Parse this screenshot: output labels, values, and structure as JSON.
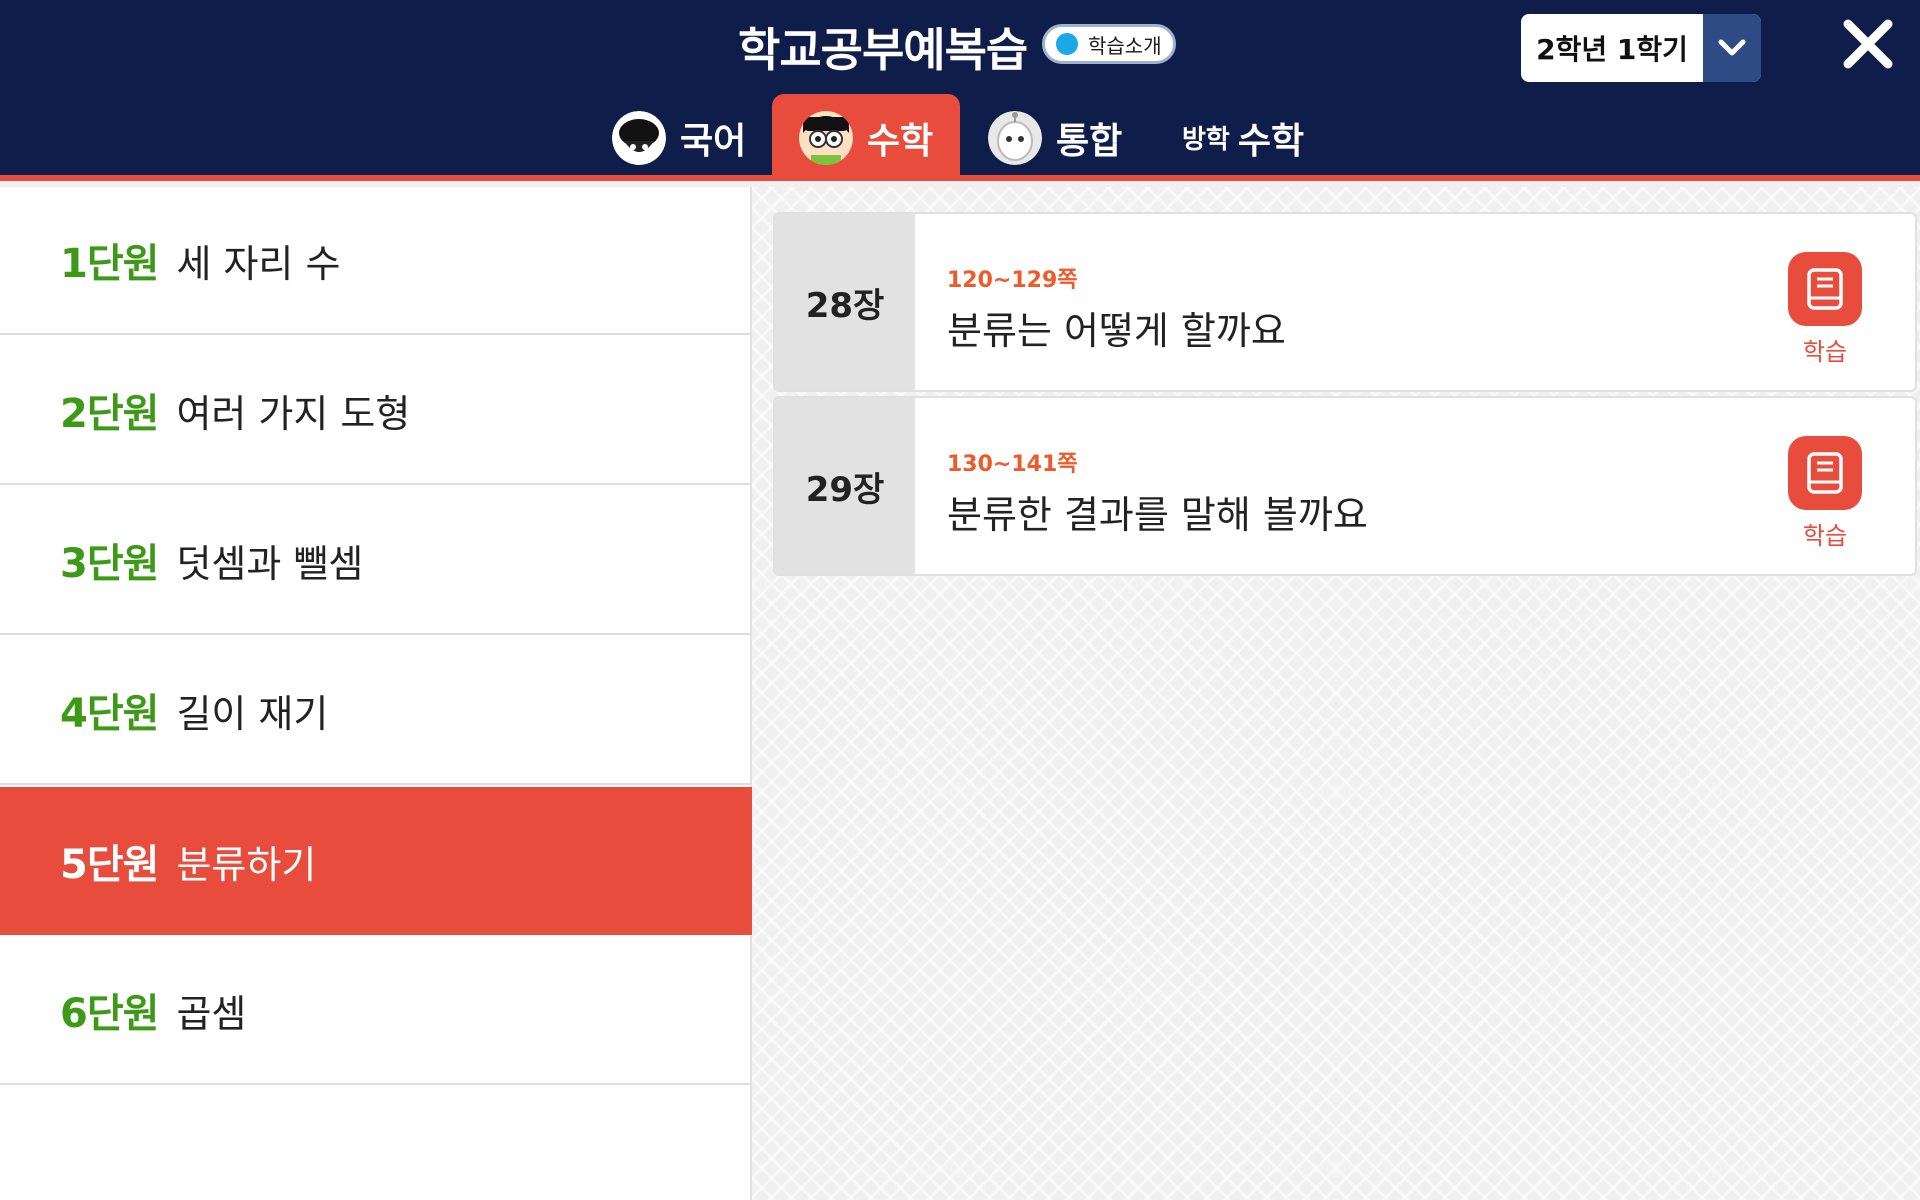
{
  "header": {
    "app_title": "학교공부예복습",
    "intro_button_label": "학습소개",
    "grade_select_value": "2학년 1학기",
    "colors": {
      "navy": "#0e1d4a",
      "accent": "#e84c3d",
      "green": "#3c9a17",
      "orange": "#ef5a2a"
    }
  },
  "tabs": [
    {
      "label": "국어",
      "icon": "ink-bottle-character-icon",
      "active": false
    },
    {
      "label": "수학",
      "icon": "boy-with-glasses-character-icon",
      "active": true
    },
    {
      "label": "통합",
      "icon": "robot-character-icon",
      "active": false
    },
    {
      "prefix": "방학",
      "label": "수학",
      "active": false
    }
  ],
  "units": [
    {
      "number": "1단원",
      "title": "세 자리 수",
      "active": false
    },
    {
      "number": "2단원",
      "title": "여러 가지 도형",
      "active": false
    },
    {
      "number": "3단원",
      "title": "덧셈과 뺄셈",
      "active": false
    },
    {
      "number": "4단원",
      "title": "길이 재기",
      "active": false
    },
    {
      "number": "5단원",
      "title": "분류하기",
      "active": true
    },
    {
      "number": "6단원",
      "title": "곱셈",
      "active": false
    }
  ],
  "lessons": [
    {
      "chapter": "28장",
      "pages": "120~129쪽",
      "title": "분류는 어떻게 할까요",
      "action_label": "학습",
      "action_icon": "book-icon"
    },
    {
      "chapter": "29장",
      "pages": "130~141쪽",
      "title": "분류한 결과를 말해 볼까요",
      "action_label": "학습",
      "action_icon": "book-icon"
    }
  ]
}
